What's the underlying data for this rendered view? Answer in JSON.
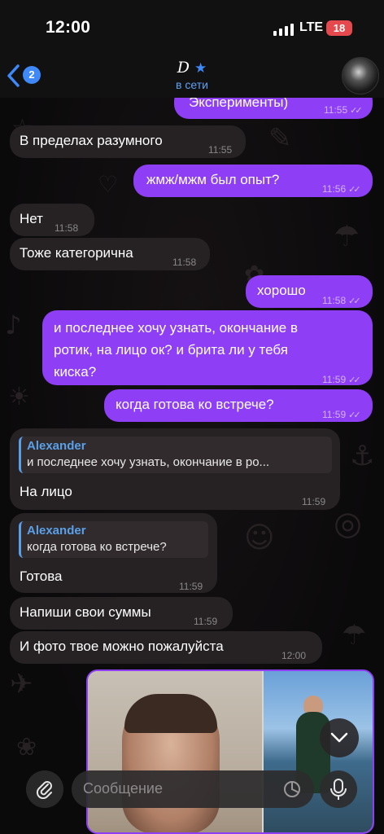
{
  "status_bar": {
    "time": "12:00",
    "network": "LTE",
    "battery": "18"
  },
  "header": {
    "back_badge": "2",
    "title": "D",
    "status": "в сети"
  },
  "messages": [
    {
      "dir": "out",
      "text": "Эксперименты)",
      "time": "11:55"
    },
    {
      "dir": "in",
      "text": "В пределах разумного",
      "time": "11:55"
    },
    {
      "dir": "out",
      "text": "жмж/мжм был опыт?",
      "time": "11:56"
    },
    {
      "dir": "in",
      "text": "Нет",
      "time": "11:58"
    },
    {
      "dir": "in",
      "text": "Тоже категорична",
      "time": "11:58"
    },
    {
      "dir": "out",
      "text": "хорошо",
      "time": "11:58"
    },
    {
      "dir": "out",
      "lines": [
        "и последнее хочу узнать, окончание в",
        "ротик, на лицо ок? и брита ли у тебя",
        "киска?"
      ],
      "time": "11:59"
    },
    {
      "dir": "out",
      "text": "когда готова ко встрече?",
      "time": "11:59"
    },
    {
      "dir": "in",
      "reply_name": "Alexander",
      "reply_text": "и последнее хочу узнать, окончание в ро...",
      "text": "На лицо",
      "time": "11:59"
    },
    {
      "dir": "in",
      "reply_name": "Alexander",
      "reply_text": "когда готова ко встрече?",
      "text": "Готова",
      "time": "11:59"
    },
    {
      "dir": "in",
      "text": "Напиши свои суммы",
      "time": "11:59"
    },
    {
      "dir": "in",
      "text": "И фото твое можно пожалуйста",
      "time": "12:00"
    }
  ],
  "input": {
    "placeholder": "Сообщение"
  },
  "colors": {
    "outgoing": "#8e3ff5",
    "incoming": "#262223",
    "accent": "#3e88f7",
    "reply": "#5aa0e8"
  }
}
